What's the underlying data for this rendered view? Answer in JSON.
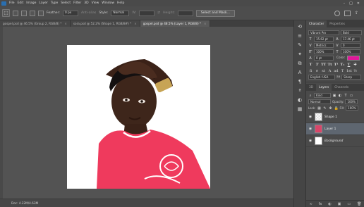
{
  "menu": [
    "File",
    "Edit",
    "Image",
    "Layer",
    "Type",
    "Select",
    "Filter",
    "3D",
    "View",
    "Window",
    "Help"
  ],
  "window_controls": [
    "–",
    "□",
    "✕"
  ],
  "options": {
    "feather_label": "Feather:",
    "feather_value": "0 px",
    "antialias": "Anti-alias",
    "style_label": "Style:",
    "style_value": "Normal",
    "width_label": "W:",
    "height_label": "Height:",
    "select_mask": "Select and Mask..."
  },
  "tabs": [
    {
      "label": "gospel.psd @ 46.5% (Group 2, RGB/8) *",
      "active": false
    },
    {
      "label": "sora.psd @ 52.2% (Shape 1, RGB/8#) *",
      "active": false
    },
    {
      "label": "gospel.psd @ 48.5% (Layer 1, RGB/8) *",
      "active": true
    }
  ],
  "status": "Doc: 4.22M/4.63M",
  "character_panel": {
    "tabs": [
      "Character",
      "Properties"
    ],
    "font_family": "Vibrant Pro",
    "font_style": "Bold",
    "font_size": "15.62 pt",
    "leading": "17.46 pt",
    "kerning": "Metrics",
    "tracking": "0",
    "vscale": "100%",
    "hscale": "100%",
    "baseline": "0 pt",
    "color_label": "Color:",
    "color": "#e0189a",
    "style_buttons": [
      "T",
      "T",
      "TT",
      "Tt",
      "T¹",
      "T₁",
      "T",
      "T"
    ],
    "extra_buttons": [
      "fi",
      "σ",
      "st",
      "A",
      "ad",
      "T",
      "1st",
      "½"
    ],
    "language": "English: USA",
    "antialias": "Sharp",
    "aa_prefix": "aa"
  },
  "layers_panel": {
    "tabs": [
      "3D",
      "Layers",
      "Channels"
    ],
    "filter_label": "Kind",
    "blend_mode": "Normal",
    "opacity_label": "Opacity:",
    "opacity": "100%",
    "lock_label": "Lock:",
    "fill_label": "Fill:",
    "fill": "100%",
    "layers": [
      {
        "name": "Shape 1",
        "selected": false
      },
      {
        "name": "Layer 1",
        "selected": true
      },
      {
        "name": "Background",
        "selected": false
      }
    ],
    "bottom_icons": [
      "∞",
      "fx",
      "◐",
      "▣",
      "▭",
      "🗑"
    ]
  }
}
